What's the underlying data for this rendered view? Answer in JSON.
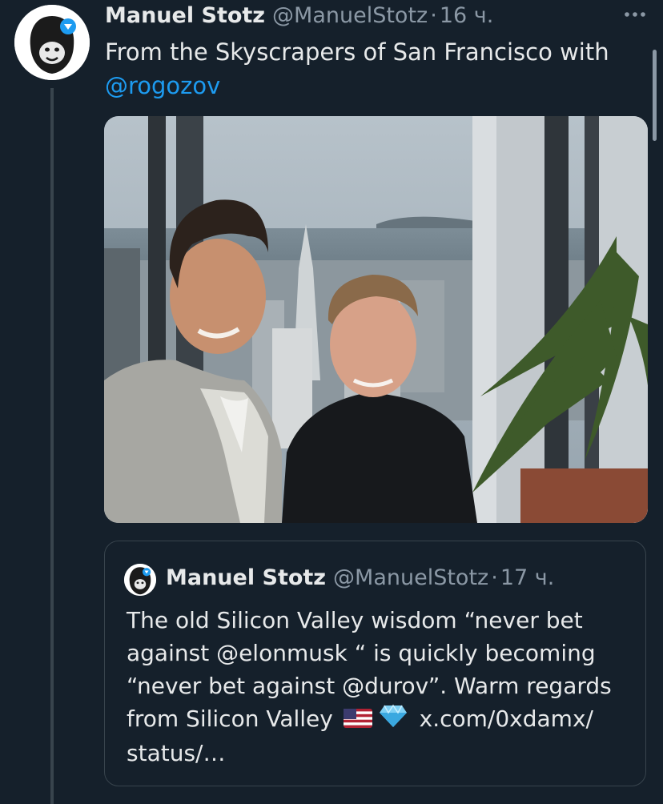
{
  "tweet": {
    "author_name": "Manuel Stotz",
    "handle": "@ManuelStotz",
    "separator": "·",
    "time": "16 ч.",
    "text": "From the Skyscrapers of San Francisco with",
    "mention": "@rogozov",
    "more_icon": "more-dots-icon"
  },
  "quoted": {
    "author_name": "Manuel Stotz",
    "handle": "@ManuelStotz",
    "separator": "·",
    "time": "17 ч.",
    "text_part1": "The old Silicon Valley wisdom “never bet against @elonmusk “ is quickly becoming “never bet against @durov”. Warm regards from Silicon Valley",
    "link": "x.com/0xdamx/ status/…"
  },
  "colors": {
    "background": "#15202b",
    "accent": "#1d9bf0",
    "muted": "#8b98a5",
    "border": "#38444d"
  }
}
